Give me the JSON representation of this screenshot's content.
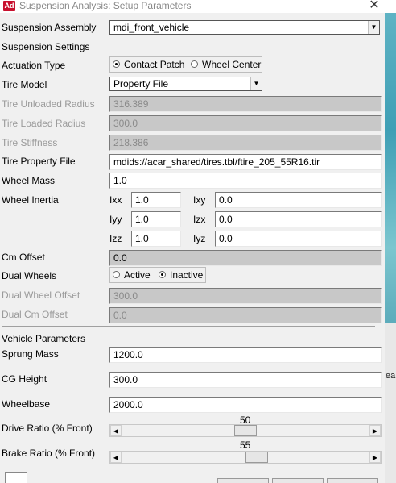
{
  "window": {
    "title": "Suspension Analysis: Setup Parameters",
    "app_icon": "Ad"
  },
  "suspension_assembly": {
    "label": "Suspension Assembly",
    "value": "mdi_front_vehicle"
  },
  "suspension_settings": {
    "label": "Suspension Settings"
  },
  "actuation_type": {
    "label": "Actuation Type",
    "options": [
      "Contact Patch",
      "Wheel Center"
    ],
    "selected": "Contact Patch"
  },
  "tire_model": {
    "label": "Tire Model",
    "value": "Property File"
  },
  "tire_unloaded_radius": {
    "label": "Tire Unloaded Radius",
    "value": "316.389"
  },
  "tire_loaded_radius": {
    "label": "Tire Loaded Radius",
    "value": "300.0"
  },
  "tire_stiffness": {
    "label": "Tire Stiffness",
    "value": "218.386"
  },
  "tire_property_file": {
    "label": "Tire Property File",
    "value": "mdids://acar_shared/tires.tbl/ftire_205_55R16.tir"
  },
  "wheel_mass": {
    "label": "Wheel Mass",
    "value": "1.0"
  },
  "wheel_inertia": {
    "label": "Wheel Inertia",
    "ixx": {
      "label": "Ixx",
      "value": "1.0"
    },
    "ixy": {
      "label": "Ixy",
      "value": "0.0"
    },
    "iyy": {
      "label": "Iyy",
      "value": "1.0"
    },
    "izx": {
      "label": "Izx",
      "value": "0.0"
    },
    "izz": {
      "label": "Izz",
      "value": "1.0"
    },
    "iyz": {
      "label": "Iyz",
      "value": "0.0"
    }
  },
  "cm_offset": {
    "label": "Cm Offset",
    "value": "0.0"
  },
  "dual_wheels": {
    "label": "Dual Wheels",
    "options": [
      "Active",
      "Inactive"
    ],
    "selected": "Inactive"
  },
  "dual_wheel_offset": {
    "label": "Dual Wheel Offset",
    "value": "300.0"
  },
  "dual_cm_offset": {
    "label": "Dual Cm Offset",
    "value": "0.0"
  },
  "vehicle_parameters": {
    "label": "Vehicle Parameters"
  },
  "sprung_mass": {
    "label": "Sprung Mass",
    "value": "1200.0"
  },
  "cg_height": {
    "label": "CG Height",
    "value": "300.0"
  },
  "wheelbase": {
    "label": "Wheelbase",
    "value": "2000.0"
  },
  "drive_ratio": {
    "label": "Drive Ratio (% Front)",
    "value": "50",
    "fraction": 0.5
  },
  "brake_ratio": {
    "label": "Brake Ratio (% Front)",
    "value": "55",
    "fraction": 0.55
  },
  "side_text": "eali"
}
